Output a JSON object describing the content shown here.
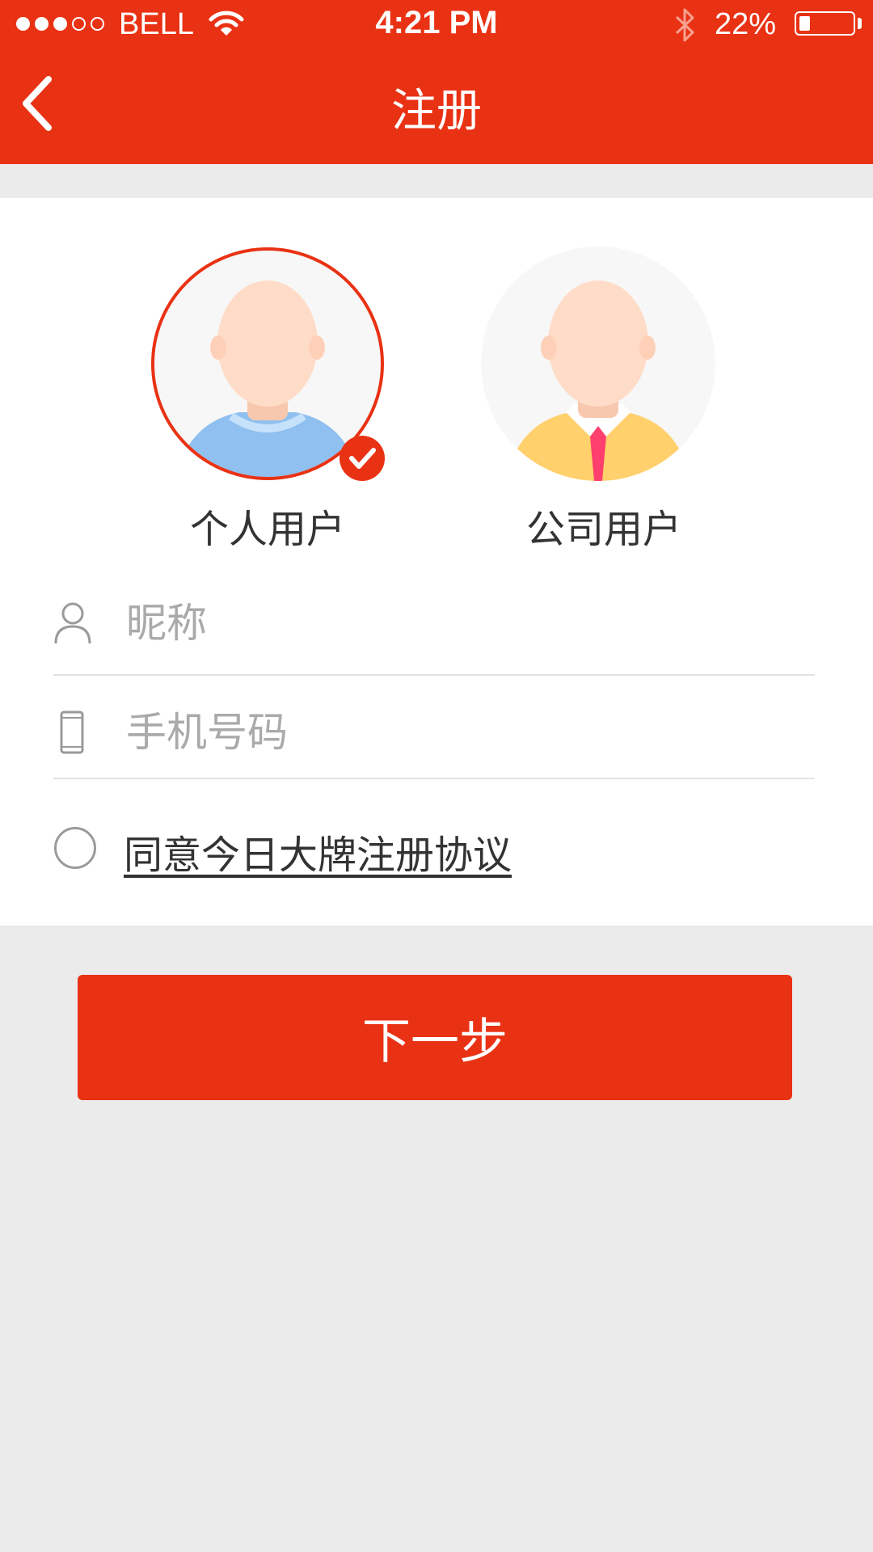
{
  "status_bar": {
    "carrier": "BELL",
    "time": "4:21 PM",
    "battery_percent": "22%",
    "signal_bars": 3,
    "signal_total": 5,
    "battery_level": 0.22
  },
  "header": {
    "title": "注册",
    "back_icon": "chevron-left-icon"
  },
  "user_types": [
    {
      "label": "个人用户",
      "selected": true
    },
    {
      "label": "公司用户",
      "selected": false
    }
  ],
  "form": {
    "nickname_placeholder": "昵称",
    "phone_placeholder": "手机号码"
  },
  "agreement": {
    "text": "同意今日大牌注册协议",
    "checked": false
  },
  "next_button": "下一步",
  "colors": {
    "brand": "#e93214",
    "background": "#ebebeb",
    "personal_shirt": "#8fc0ef",
    "company_shirt": "#ffd06b",
    "tie": "#ff3f6e",
    "skin": "#ffdcc8"
  }
}
